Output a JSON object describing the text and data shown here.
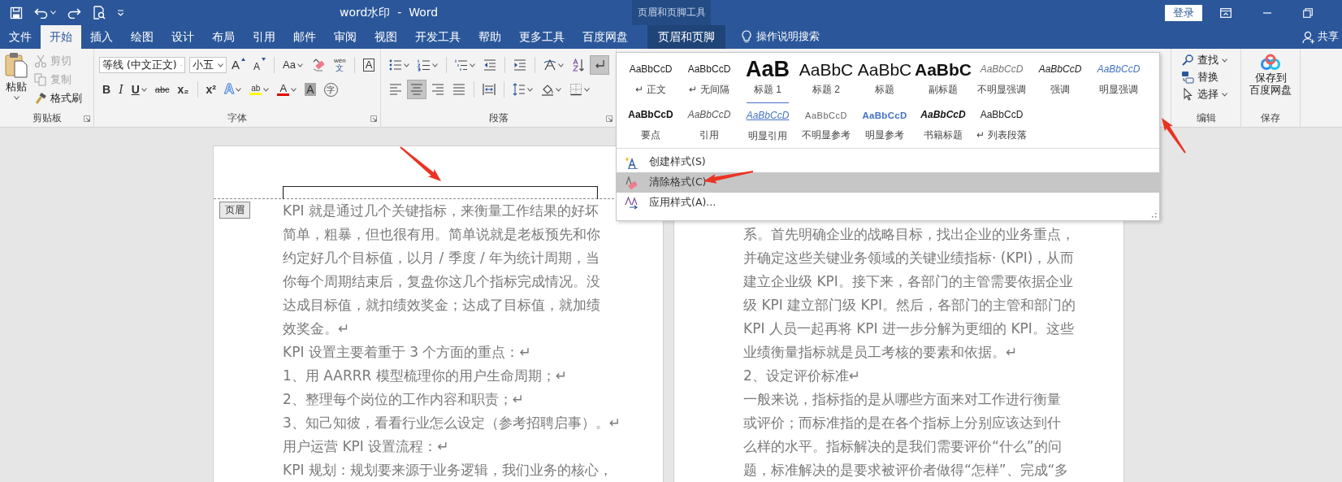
{
  "title_bar": {
    "title": "word水印  -  Word",
    "context_title": "页眉和页脚工具",
    "sign_in": "登录"
  },
  "tabs": [
    {
      "label": "文件",
      "selected": false,
      "kind": "normal"
    },
    {
      "label": "开始",
      "selected": true,
      "kind": "normal"
    },
    {
      "label": "插入",
      "selected": false,
      "kind": "normal"
    },
    {
      "label": "绘图",
      "selected": false,
      "kind": "normal"
    },
    {
      "label": "设计",
      "selected": false,
      "kind": "normal"
    },
    {
      "label": "布局",
      "selected": false,
      "kind": "normal"
    },
    {
      "label": "引用",
      "selected": false,
      "kind": "normal"
    },
    {
      "label": "邮件",
      "selected": false,
      "kind": "normal"
    },
    {
      "label": "审阅",
      "selected": false,
      "kind": "normal"
    },
    {
      "label": "视图",
      "selected": false,
      "kind": "normal"
    },
    {
      "label": "开发工具",
      "selected": false,
      "kind": "normal"
    },
    {
      "label": "帮助",
      "selected": false,
      "kind": "normal"
    },
    {
      "label": "更多工具",
      "selected": false,
      "kind": "normal"
    },
    {
      "label": "百度网盘",
      "selected": false,
      "kind": "normal"
    },
    {
      "label": "页眉和页脚",
      "selected": false,
      "kind": "contextual"
    }
  ],
  "tell_me": "操作说明搜索",
  "share": "共享",
  "clipboard": {
    "paste": "粘贴",
    "group_label": "剪贴板",
    "items": [
      {
        "label": "剪切",
        "kind": "cut",
        "disabled": true
      },
      {
        "label": "复制",
        "kind": "copy",
        "disabled": true
      },
      {
        "label": "格式刷",
        "kind": "painter",
        "disabled": false
      }
    ]
  },
  "font": {
    "name": "等线 (中文正文)",
    "size": "小五",
    "group_label": "字体",
    "row1": [
      {
        "kind": "grow",
        "glyph": "A",
        "caret": false
      },
      {
        "kind": "shrink",
        "glyph": "A",
        "caret": false
      },
      {
        "kind": "case",
        "glyph": "Aa",
        "caret": true
      },
      {
        "kind": "clear-format",
        "caret": false
      },
      {
        "kind": "phonetic",
        "glyph": "wén",
        "sub": "文",
        "caret": false
      },
      {
        "kind": "border",
        "glyph": "A",
        "caret": false
      }
    ],
    "row2": [
      {
        "kind": "bold",
        "glyph": "B",
        "caret": false
      },
      {
        "kind": "italic",
        "glyph": "I",
        "caret": false
      },
      {
        "kind": "underline",
        "glyph": "U",
        "caret": true
      },
      {
        "kind": "strike",
        "glyph": "abc",
        "caret": false
      },
      {
        "kind": "subscript",
        "glyph": "x₂",
        "caret": false
      },
      {
        "kind": "superscript",
        "glyph": "x²",
        "caret": false
      },
      {
        "kind": "effects",
        "glyph": "A",
        "caret": true
      },
      {
        "kind": "highlight",
        "glyph": "ab",
        "caret": true
      },
      {
        "kind": "font-color",
        "glyph": "A",
        "caret": true
      },
      {
        "kind": "shading",
        "glyph": "A",
        "caret": false
      },
      {
        "kind": "enclose",
        "glyph": "字",
        "caret": false
      }
    ]
  },
  "paragraph": {
    "group_label": "段落",
    "row1": [
      {
        "kind": "bullets",
        "caret": true,
        "selected": false
      },
      {
        "kind": "numbering",
        "caret": true,
        "selected": false
      },
      {
        "kind": "multilevel",
        "caret": true,
        "selected": false
      },
      {
        "kind": "outdent",
        "caret": false,
        "selected": false
      },
      {
        "kind": "indent",
        "caret": false,
        "selected": false
      },
      {
        "kind": "asian-layout",
        "caret": true,
        "selected": false
      },
      {
        "kind": "sort",
        "caret": false,
        "selected": false
      },
      {
        "kind": "marks",
        "caret": false,
        "selected": true
      }
    ],
    "row2": [
      {
        "kind": "align-left",
        "caret": false,
        "selected": false
      },
      {
        "kind": "align-center",
        "caret": false,
        "selected": true
      },
      {
        "kind": "align-right",
        "caret": false,
        "selected": false
      },
      {
        "kind": "justify",
        "caret": false,
        "selected": false
      },
      {
        "kind": "distribute",
        "caret": false,
        "selected": false
      },
      {
        "kind": "line-spacing",
        "caret": true,
        "selected": false
      },
      {
        "kind": "fill",
        "caret": true,
        "selected": false
      },
      {
        "kind": "borders",
        "caret": true,
        "selected": false
      }
    ]
  },
  "editing": {
    "group_label": "编辑",
    "items": [
      {
        "label": "查找",
        "kind": "find",
        "caret": true
      },
      {
        "label": "替换",
        "kind": "replace",
        "caret": false
      },
      {
        "label": "选择",
        "kind": "select",
        "caret": true
      }
    ]
  },
  "save": {
    "group_label": "保存",
    "label_lines": [
      "保存到",
      "百度网盘"
    ]
  },
  "styles_menu": {
    "styles": [
      {
        "preview": "AaBbCcD",
        "label": "↵ 正文",
        "kind": "normal"
      },
      {
        "preview": "AaBbCcD",
        "label": "↵ 无间隔",
        "kind": "normal"
      },
      {
        "preview": "AaB",
        "label": "标题 1",
        "kind": "heading1"
      },
      {
        "preview": "AaBbC",
        "label": "标题 2",
        "kind": "heading2"
      },
      {
        "preview": "AaBbC",
        "label": "标题",
        "kind": "title"
      },
      {
        "preview": "AaBbC",
        "label": "副标题",
        "kind": "subtitle"
      },
      {
        "preview": "AaBbCcD",
        "label": "不明显强调",
        "kind": "subtle-emphasis"
      },
      {
        "preview": "AaBbCcD",
        "label": "强调",
        "kind": "emphasis"
      },
      {
        "preview": "AaBbCcD",
        "label": "明显强调",
        "kind": "intense-emphasis"
      },
      {
        "preview": "AaBbCcD",
        "label": "要点",
        "kind": "strong"
      },
      {
        "preview": "AaBbCcD",
        "label": "引用",
        "kind": "quote"
      },
      {
        "preview": "AaBbCcD",
        "label": "明显引用",
        "kind": "intense-quote"
      },
      {
        "preview": "AaBbCcD",
        "label": "不明显参考",
        "kind": "subtle-reference"
      },
      {
        "preview": "AaBbCcD",
        "label": "明显参考",
        "kind": "intense-reference"
      },
      {
        "preview": "AaBbCcD",
        "label": "书籍标题",
        "kind": "book-title"
      },
      {
        "preview": "AaBbCcD",
        "label": "↵ 列表段落",
        "kind": "normal"
      }
    ],
    "commands": [
      {
        "label": "创建样式(S)",
        "kind": "create",
        "selected": false
      },
      {
        "label": "清除格式(C)",
        "kind": "clear",
        "selected": true
      },
      {
        "label": "应用样式(A)...",
        "kind": "apply",
        "selected": false
      }
    ]
  },
  "pages": [
    {
      "header_tag": "页眉",
      "paragraphs": [
        [
          "KPI  就是通过几个关键指标，来衡量工作结果的好坏",
          "简单，粗暴，但也很有用。简单说就是老板预先和你",
          "约定好几个目标值，以月 / 季度 / 年为统计周期，当",
          "你每个周期结束后，复盘你这几个指标完成情况。没",
          "达成目标值，就扣绩效奖金；达成了目标值，就加绩",
          "效奖金。↵"
        ],
        [
          "KPI 设置主要着重于 3 个方面的重点：↵"
        ],
        [
          "1、用 AARRR 模型梳理你的用户生命周期；↵"
        ],
        [
          "2、整理每个岗位的工作内容和职责；↵"
        ],
        [
          "3、知己知彼，看看行业怎么设定（参考招聘启事）。↵"
        ],
        [
          "用户运营 KPI 设置流程：↵"
        ],
        [
          "KPI 规划：规划要来源于业务逻辑，我们业务的核心，"
        ]
      ]
    },
    {
      "paragraphs": [
        [
          "系。首先明确企业的战略目标，找出企业的业务重点，",
          "并确定这些关键业务领域的关键业绩指标· (KPI)，从而",
          "建立企业级 KPI。接下来，各部门的主管需要依据企业",
          "级 KPI 建立部门级 KPI。然后，各部门的主管和部门的",
          "KPI 人员一起再将 KPI 进一步分解为更细的 KPI。这些",
          "业绩衡量指标就是员工考核的要素和依据。↵"
        ],
        [
          "2、设定评价标准↵"
        ],
        [
          "一般来说，指标指的是从哪些方面来对工作进行衡量",
          "或评价；而标准指的是在各个指标上分别应该达到什",
          "么样的水平。指标解决的是我们需要评价“什么”的问",
          "题，标准解决的是要求被评价者做得“怎样”、完成“多"
        ]
      ]
    }
  ]
}
